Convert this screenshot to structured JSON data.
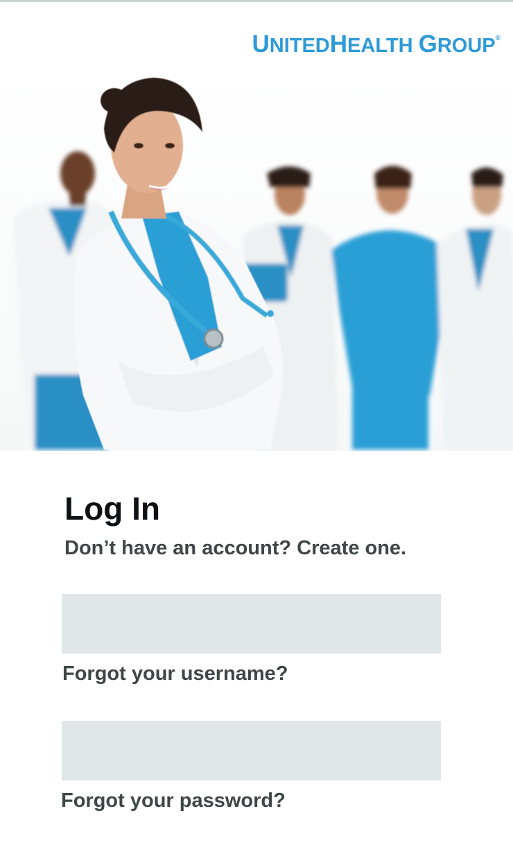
{
  "brand": {
    "logo_text": "UNITEDHEALTH GROUP",
    "color": "#2e9ad8"
  },
  "hero": {
    "image": "group-of-medical-staff-photo"
  },
  "login": {
    "title": "Log In",
    "account_prompt": "Don’t have an account? ",
    "create_link": "Create one.",
    "username_value": "",
    "password_value": "",
    "forgot_username": "Forgot your username?",
    "forgot_password": "Forgot your password?"
  },
  "colors": {
    "field_bg": "#e1e7e8",
    "text_dark": "#0f1214",
    "text_gray": "#3f4648",
    "scrub_blue": "#2a9fd6"
  }
}
